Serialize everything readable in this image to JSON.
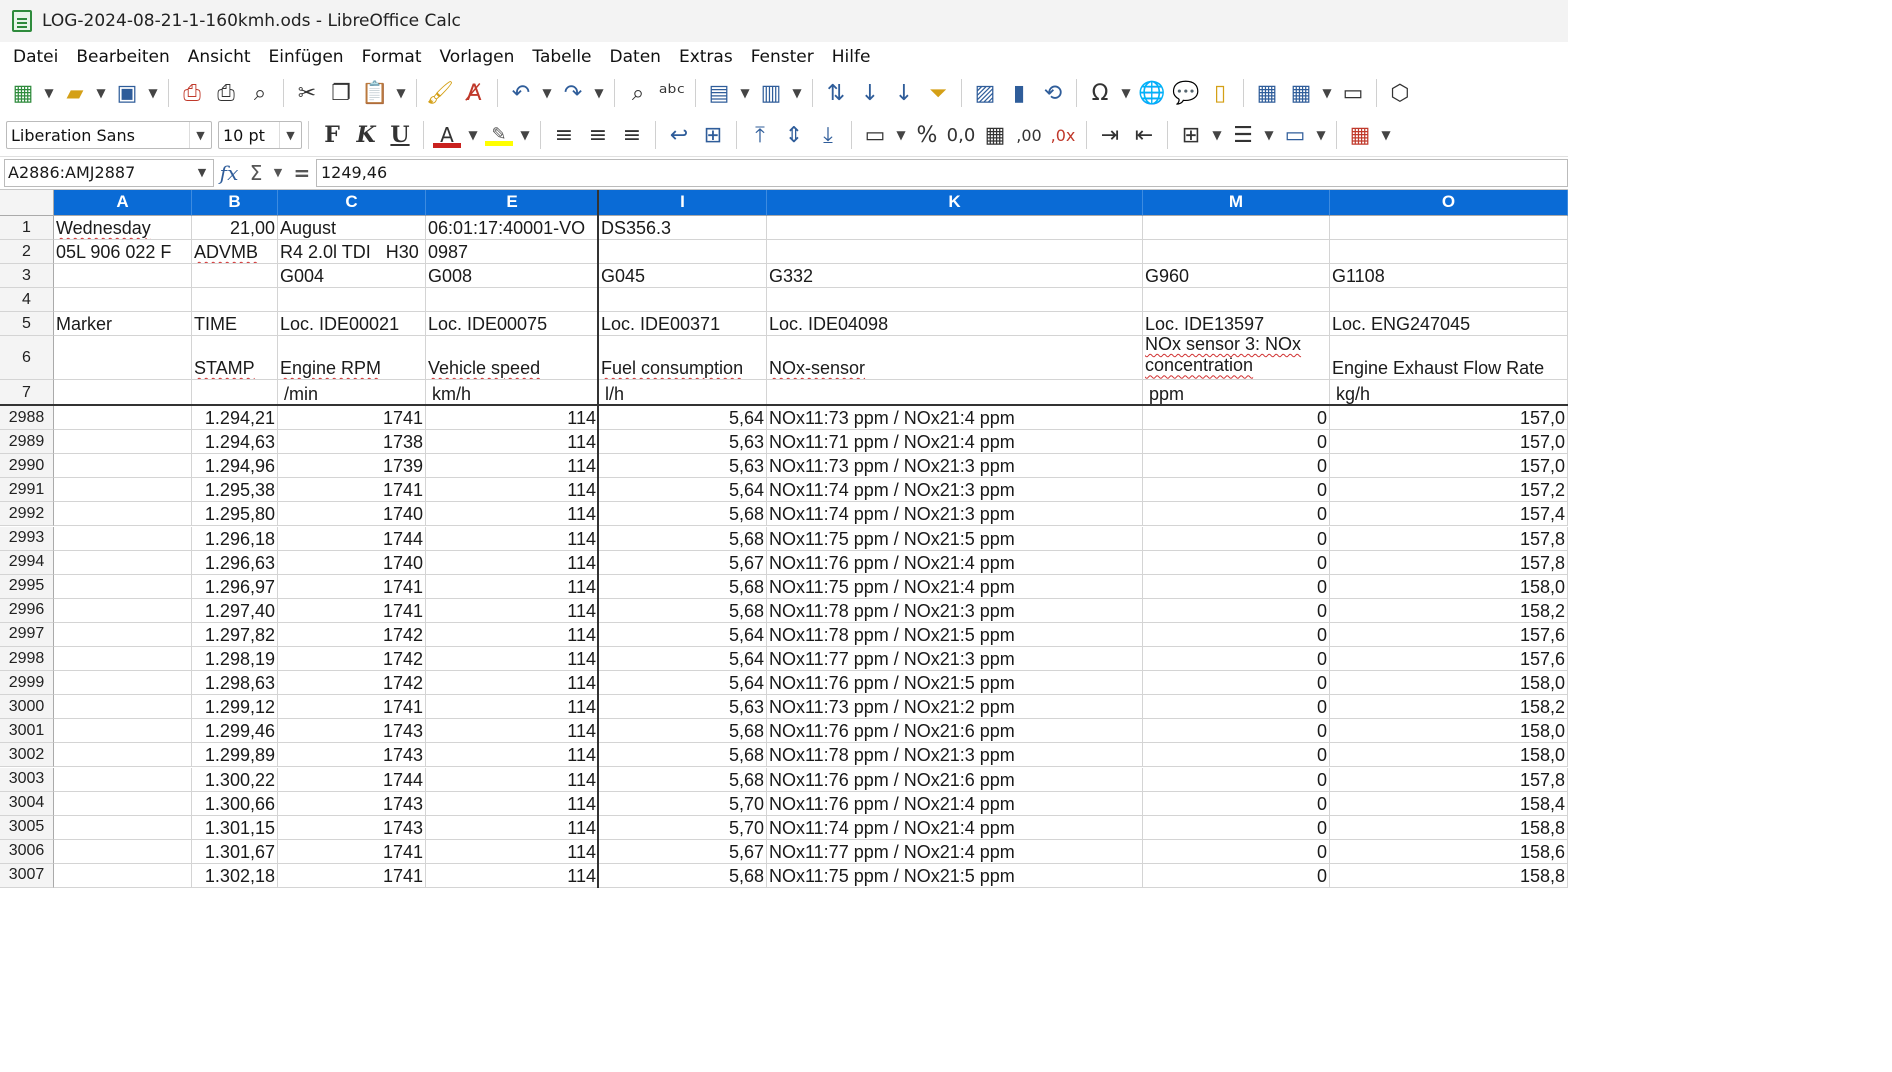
{
  "window": {
    "title": "LOG-2024-08-21-1-160kmh.ods - LibreOffice Calc"
  },
  "menu": [
    "Datei",
    "Bearbeiten",
    "Ansicht",
    "Einfügen",
    "Format",
    "Vorlagen",
    "Tabelle",
    "Daten",
    "Extras",
    "Fenster",
    "Hilfe"
  ],
  "font": {
    "name": "Liberation Sans",
    "size": "10 pt"
  },
  "formula": {
    "name_box": "A2886:AMJ2887",
    "value": "1249,46"
  },
  "columns": [
    "A",
    "B",
    "C",
    "E",
    "I",
    "K",
    "M",
    "O"
  ],
  "header_rows": [
    {
      "num": "1",
      "cells": [
        "Wednesday",
        "21,00",
        "August",
        "06:01:17:40001-VO",
        "DS356.3",
        "",
        "",
        ""
      ]
    },
    {
      "num": "2",
      "cells": [
        "05L 906 022 F",
        "ADVMB",
        "R4 2.0l TDI   H30",
        "0987",
        "",
        "",
        "",
        ""
      ]
    },
    {
      "num": "3",
      "cells": [
        "",
        "",
        "G004",
        "G008",
        "G045",
        "G332",
        "G960",
        "G1108"
      ]
    },
    {
      "num": "4",
      "cells": [
        "",
        "",
        "",
        "",
        "",
        "",
        "",
        ""
      ]
    },
    {
      "num": "5",
      "cells": [
        "Marker",
        "TIME",
        "Loc. IDE00021",
        "Loc. IDE00075",
        "Loc. IDE00371",
        "Loc. IDE04098",
        "Loc. IDE13597",
        "Loc. ENG247045"
      ]
    },
    {
      "num": "6",
      "cells": [
        "",
        "STAMP",
        "Engine RPM",
        "Vehicle speed",
        "Fuel consumption",
        "NOx-sensor",
        "NOx sensor 3: NOx concentration",
        "Engine Exhaust Flow Rate"
      ]
    },
    {
      "num": "7",
      "cells": [
        "",
        "",
        "/min",
        "km/h",
        "l/h",
        "",
        "ppm",
        "kg/h"
      ]
    }
  ],
  "data_rows": [
    {
      "num": "2988",
      "b": "1.294,21",
      "c": "1741",
      "e": "114",
      "i": "5,64",
      "k": "NOx11:73 ppm / NOx21:4 ppm",
      "m": "0",
      "o": "157,0"
    },
    {
      "num": "2989",
      "b": "1.294,63",
      "c": "1738",
      "e": "114",
      "i": "5,63",
      "k": "NOx11:71 ppm / NOx21:4 ppm",
      "m": "0",
      "o": "157,0"
    },
    {
      "num": "2990",
      "b": "1.294,96",
      "c": "1739",
      "e": "114",
      "i": "5,63",
      "k": "NOx11:73 ppm / NOx21:3 ppm",
      "m": "0",
      "o": "157,0"
    },
    {
      "num": "2991",
      "b": "1.295,38",
      "c": "1741",
      "e": "114",
      "i": "5,64",
      "k": "NOx11:74 ppm / NOx21:3 ppm",
      "m": "0",
      "o": "157,2"
    },
    {
      "num": "2992",
      "b": "1.295,80",
      "c": "1740",
      "e": "114",
      "i": "5,68",
      "k": "NOx11:74 ppm / NOx21:3 ppm",
      "m": "0",
      "o": "157,4"
    },
    {
      "num": "2993",
      "b": "1.296,18",
      "c": "1744",
      "e": "114",
      "i": "5,68",
      "k": "NOx11:75 ppm / NOx21:5 ppm",
      "m": "0",
      "o": "157,8"
    },
    {
      "num": "2994",
      "b": "1.296,63",
      "c": "1740",
      "e": "114",
      "i": "5,67",
      "k": "NOx11:76 ppm / NOx21:4 ppm",
      "m": "0",
      "o": "157,8"
    },
    {
      "num": "2995",
      "b": "1.296,97",
      "c": "1741",
      "e": "114",
      "i": "5,68",
      "k": "NOx11:75 ppm / NOx21:4 ppm",
      "m": "0",
      "o": "158,0"
    },
    {
      "num": "2996",
      "b": "1.297,40",
      "c": "1741",
      "e": "114",
      "i": "5,68",
      "k": "NOx11:78 ppm / NOx21:3 ppm",
      "m": "0",
      "o": "158,2"
    },
    {
      "num": "2997",
      "b": "1.297,82",
      "c": "1742",
      "e": "114",
      "i": "5,64",
      "k": "NOx11:78 ppm / NOx21:5 ppm",
      "m": "0",
      "o": "157,6"
    },
    {
      "num": "2998",
      "b": "1.298,19",
      "c": "1742",
      "e": "114",
      "i": "5,64",
      "k": "NOx11:77 ppm / NOx21:3 ppm",
      "m": "0",
      "o": "157,6"
    },
    {
      "num": "2999",
      "b": "1.298,63",
      "c": "1742",
      "e": "114",
      "i": "5,64",
      "k": "NOx11:76 ppm / NOx21:5 ppm",
      "m": "0",
      "o": "158,0"
    },
    {
      "num": "3000",
      "b": "1.299,12",
      "c": "1741",
      "e": "114",
      "i": "5,63",
      "k": "NOx11:73 ppm / NOx21:2 ppm",
      "m": "0",
      "o": "158,2"
    },
    {
      "num": "3001",
      "b": "1.299,46",
      "c": "1743",
      "e": "114",
      "i": "5,68",
      "k": "NOx11:76 ppm / NOx21:6 ppm",
      "m": "0",
      "o": "158,0"
    },
    {
      "num": "3002",
      "b": "1.299,89",
      "c": "1743",
      "e": "114",
      "i": "5,68",
      "k": "NOx11:78 ppm / NOx21:3 ppm",
      "m": "0",
      "o": "158,0"
    },
    {
      "num": "3003",
      "b": "1.300,22",
      "c": "1744",
      "e": "114",
      "i": "5,68",
      "k": "NOx11:76 ppm / NOx21:6 ppm",
      "m": "0",
      "o": "157,8"
    },
    {
      "num": "3004",
      "b": "1.300,66",
      "c": "1743",
      "e": "114",
      "i": "5,70",
      "k": "NOx11:76 ppm / NOx21:4 ppm",
      "m": "0",
      "o": "158,4"
    },
    {
      "num": "3005",
      "b": "1.301,15",
      "c": "1743",
      "e": "114",
      "i": "5,70",
      "k": "NOx11:74 ppm / NOx21:4 ppm",
      "m": "0",
      "o": "158,8"
    },
    {
      "num": "3006",
      "b": "1.301,67",
      "c": "1741",
      "e": "114",
      "i": "5,67",
      "k": "NOx11:77 ppm / NOx21:4 ppm",
      "m": "0",
      "o": "158,6"
    },
    {
      "num": "3007",
      "b": "1.302,18",
      "c": "1741",
      "e": "114",
      "i": "5,68",
      "k": "NOx11:75 ppm / NOx21:5 ppm",
      "m": "0",
      "o": "158,8"
    }
  ],
  "colors": {
    "column_header": "#0a6bd6",
    "frozen_line": "#333333"
  }
}
